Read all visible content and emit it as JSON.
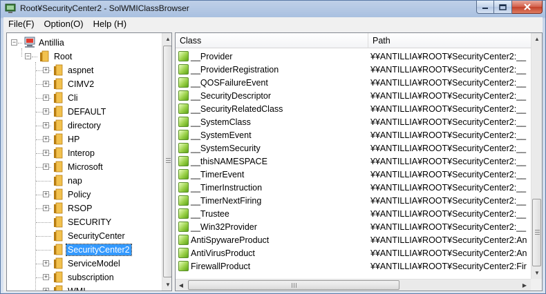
{
  "window": {
    "title": "Root¥SecurityCenter2 - SolWMIClassBrowser"
  },
  "menu": [
    {
      "label": "File(F)"
    },
    {
      "label": "Option(O)"
    },
    {
      "label": "Help (H)"
    }
  ],
  "tree": {
    "computer": "Antillia",
    "root": "Root",
    "children": [
      {
        "label": "aspnet",
        "expandable": true
      },
      {
        "label": "CIMV2",
        "expandable": true
      },
      {
        "label": "Cli",
        "expandable": true
      },
      {
        "label": "DEFAULT",
        "expandable": true
      },
      {
        "label": "directory",
        "expandable": true
      },
      {
        "label": "HP",
        "expandable": true
      },
      {
        "label": "Interop",
        "expandable": true
      },
      {
        "label": "Microsoft",
        "expandable": true
      },
      {
        "label": "nap",
        "expandable": false
      },
      {
        "label": "Policy",
        "expandable": true
      },
      {
        "label": "RSOP",
        "expandable": true
      },
      {
        "label": "SECURITY",
        "expandable": false
      },
      {
        "label": "SecurityCenter",
        "expandable": false
      },
      {
        "label": "SecurityCenter2",
        "expandable": false,
        "selected": true
      },
      {
        "label": "ServiceModel",
        "expandable": true
      },
      {
        "label": "subscription",
        "expandable": true
      },
      {
        "label": "WMI",
        "expandable": true
      }
    ]
  },
  "list": {
    "columns": {
      "class": "Class",
      "path": "Path"
    },
    "rows": [
      {
        "class": "__Provider",
        "path": "¥¥ANTILLIA¥ROOT¥SecurityCenter2:__",
        "icon": true
      },
      {
        "class": "__ProviderRegistration",
        "path": "¥¥ANTILLIA¥ROOT¥SecurityCenter2:__",
        "icon": true
      },
      {
        "class": "__QOSFailureEvent",
        "path": "¥¥ANTILLIA¥ROOT¥SecurityCenter2:__",
        "icon": true
      },
      {
        "class": "__SecurityDescriptor",
        "path": "¥¥ANTILLIA¥ROOT¥SecurityCenter2:__",
        "icon": true
      },
      {
        "class": "__SecurityRelatedClass",
        "path": "¥¥ANTILLIA¥ROOT¥SecurityCenter2:__",
        "icon": true
      },
      {
        "class": "__SystemClass",
        "path": "¥¥ANTILLIA¥ROOT¥SecurityCenter2:__",
        "icon": true
      },
      {
        "class": "__SystemEvent",
        "path": "¥¥ANTILLIA¥ROOT¥SecurityCenter2:__",
        "icon": true
      },
      {
        "class": "__SystemSecurity",
        "path": "¥¥ANTILLIA¥ROOT¥SecurityCenter2:__",
        "icon": true
      },
      {
        "class": "__thisNAMESPACE",
        "path": "¥¥ANTILLIA¥ROOT¥SecurityCenter2:__",
        "icon": true
      },
      {
        "class": "__TimerEvent",
        "path": "¥¥ANTILLIA¥ROOT¥SecurityCenter2:__",
        "icon": true
      },
      {
        "class": "__TimerInstruction",
        "path": "¥¥ANTILLIA¥ROOT¥SecurityCenter2:__",
        "icon": true
      },
      {
        "class": "__TimerNextFiring",
        "path": "¥¥ANTILLIA¥ROOT¥SecurityCenter2:__",
        "icon": true
      },
      {
        "class": "__Trustee",
        "path": "¥¥ANTILLIA¥ROOT¥SecurityCenter2:__",
        "icon": true
      },
      {
        "class": "__Win32Provider",
        "path": "¥¥ANTILLIA¥ROOT¥SecurityCenter2:__",
        "icon": true
      },
      {
        "class": "AntiSpywareProduct",
        "path": "¥¥ANTILLIA¥ROOT¥SecurityCenter2:An",
        "icon": false
      },
      {
        "class": "AntiVirusProduct",
        "path": "¥¥ANTILLIA¥ROOT¥SecurityCenter2:An",
        "icon": false
      },
      {
        "class": "FirewallProduct",
        "path": "¥¥ANTILLIA¥ROOT¥SecurityCenter2:Fir",
        "icon": false
      }
    ]
  },
  "icons": {
    "app": "wmi-browser-icon",
    "computer": "computer-icon",
    "folder": "folder-icon",
    "class": "class-icon"
  },
  "colors": {
    "selection": "#3399ff",
    "folder": "#e8b33a",
    "class_icon": "#8cc63f"
  }
}
